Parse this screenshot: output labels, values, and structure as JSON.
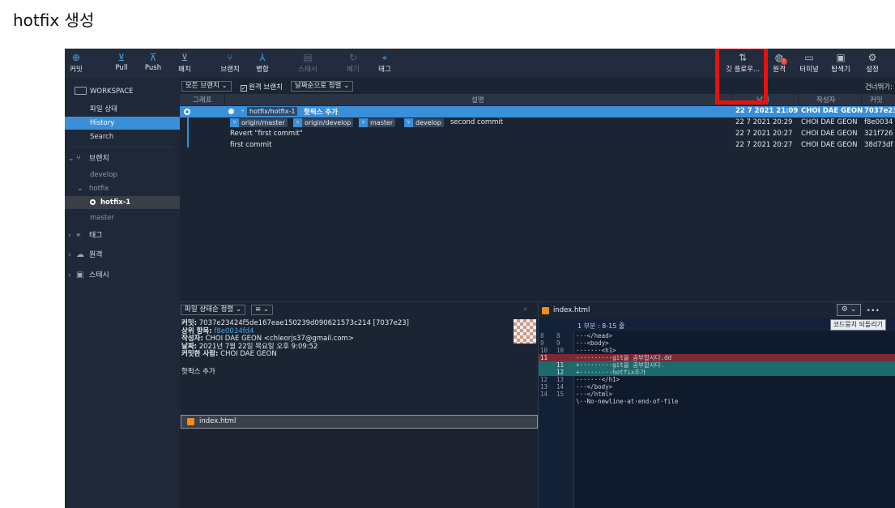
{
  "page": {
    "heading": "hotfix 생성"
  },
  "toolbar": {
    "left": [
      {
        "label": "커밋",
        "icon": "plus-circle-icon"
      },
      {
        "label": "Pull",
        "icon": "arrow-down-circle-icon"
      },
      {
        "label": "Push",
        "icon": "arrow-up-circle-icon"
      },
      {
        "label": "패치",
        "icon": "arrow-down-disabled-icon"
      },
      {
        "label": "브랜치",
        "icon": "branch-icon"
      },
      {
        "label": "병합",
        "icon": "merge-icon"
      },
      {
        "label": "스태시",
        "icon": "stash-icon"
      },
      {
        "label": "폐기",
        "icon": "discard-icon"
      },
      {
        "label": "태그",
        "icon": "tag-icon"
      }
    ],
    "right": [
      {
        "label": "깃 플로우...",
        "icon": "git-flow-icon"
      },
      {
        "label": "원격",
        "icon": "globe-icon"
      },
      {
        "label": "터미널",
        "icon": "terminal-icon"
      },
      {
        "label": "탐색기",
        "icon": "folder-icon"
      },
      {
        "label": "설정",
        "icon": "gear-icon"
      }
    ],
    "remote_badge": "!"
  },
  "sidebar": {
    "workspace_label": "WORKSPACE",
    "workspace_items": [
      "파일 상태",
      "History",
      "Search"
    ],
    "branches_label": "브랜치",
    "branches": {
      "develop": "develop",
      "hotfix_folder": "hotfix",
      "current": "hotfix-1",
      "master": "master"
    },
    "tags_label": "태그",
    "remotes_label": "원격",
    "stash_label": "스태시"
  },
  "filters": {
    "all_branches": "모든 브랜치",
    "remote_branches": "원격 브랜치",
    "sort": "날짜순으로 정렬",
    "skip": "건너뛰기:"
  },
  "columns": {
    "graph": "그래프",
    "description": "설명",
    "date": "날짜",
    "author": "작성자",
    "commit": "커밋"
  },
  "commits": [
    {
      "tags": [
        "hotfix/hotfix-1"
      ],
      "message": "핫픽스 추가",
      "date": "22 7 2021 21:09",
      "author": "CHOI DAE GEON",
      "hash": "7037e23"
    },
    {
      "tags": [
        "origin/master",
        "origin/develop",
        "master",
        "develop"
      ],
      "message": "second commit",
      "date": "22 7 2021 20:29",
      "author": "CHOI DAE GEON",
      "hash": "f8e0034"
    },
    {
      "tags": [],
      "message": "Revert \"first commit\"",
      "date": "22 7 2021 20:27",
      "author": "CHOI DAE GEON",
      "hash": "321f726"
    },
    {
      "tags": [],
      "message": "first commit",
      "date": "22 7 2021 20:27",
      "author": "CHOI DAE GEON",
      "hash": "38d73df"
    }
  ],
  "details": {
    "sort_dropdown": "파일 상태순 정렬",
    "view_dropdown": "≡",
    "commit_label": "커밋:",
    "commit_value": "7037e23424f5de167eae150239d090621573c214 [7037e23]",
    "parent_label": "상위 항목:",
    "parent_value": "f8e0034fd4",
    "author_label": "작성자:",
    "author_value": "CHOI DAE GEON <chleorjs37@gmail.com>",
    "date_label": "날짜:",
    "date_value": "2021년 7월 22일 목요일 오후 9:09:52",
    "committer_label": "커밋한 사람:",
    "committer_value": "CHOI DAE GEON",
    "message": "핫픽스 추가",
    "file": "index.html"
  },
  "diff": {
    "file": "index.html",
    "hunk": "1 부분 : 8-15 줄",
    "revert_button": "코드뭉치 되돌리기",
    "lines": [
      {
        "type": "ctx",
        "old": "8",
        "new": "8",
        "code": "···</head>"
      },
      {
        "type": "ctx",
        "old": "9",
        "new": "9",
        "code": "···<body>"
      },
      {
        "type": "ctx",
        "old": "10",
        "new": "10",
        "code": "·······<h1>"
      },
      {
        "type": "del",
        "old": "11",
        "new": "",
        "code": "-·········git을 공부합시다.dd"
      },
      {
        "type": "add",
        "old": "",
        "new": "11",
        "code": "+·········git을 공부합시다."
      },
      {
        "type": "add",
        "old": "",
        "new": "12",
        "code": "+·········hotfix추가"
      },
      {
        "type": "ctx",
        "old": "12",
        "new": "13",
        "code": "·······</h1>"
      },
      {
        "type": "ctx",
        "old": "13",
        "new": "14",
        "code": "···</body>"
      },
      {
        "type": "ctx",
        "old": "14",
        "new": "15",
        "code": "···</html>"
      },
      {
        "type": "ctx",
        "old": "",
        "new": "",
        "code": "\\··No·newline·at·end·of·file"
      }
    ]
  }
}
